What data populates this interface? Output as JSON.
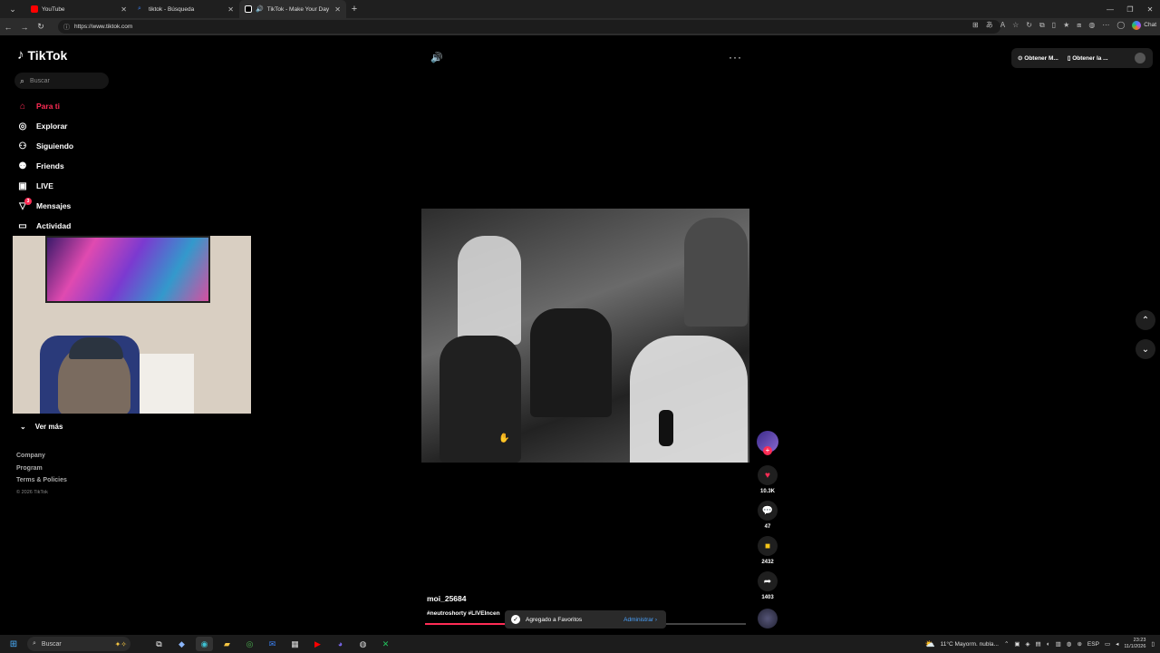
{
  "browser": {
    "tabs": [
      {
        "title": "YouTube",
        "color": "#ff0000"
      },
      {
        "title": "tiktok - Búsqueda",
        "color": "#3b82f6"
      },
      {
        "title": "TikTok - Make Your Day",
        "color": "#ffffff"
      }
    ],
    "url": "https://www.tiktok.com",
    "copilot_label": "Chat"
  },
  "tiktok": {
    "logo_text": "TikTok",
    "search_placeholder": "Buscar",
    "menu": [
      {
        "label": "Para ti",
        "icon": "home-icon"
      },
      {
        "label": "Explorar",
        "icon": "compass-icon"
      },
      {
        "label": "Siguiendo",
        "icon": "following-icon"
      },
      {
        "label": "Friends",
        "icon": "friends-icon"
      },
      {
        "label": "LIVE",
        "icon": "live-icon"
      },
      {
        "label": "Mensajes",
        "icon": "messages-icon",
        "badge": "3"
      },
      {
        "label": "Actividad",
        "icon": "activity-icon"
      }
    ],
    "ver_mas": "Ver más",
    "footer": {
      "company": "Company",
      "program": "Program",
      "terms": "Terms & Policies",
      "copyright": "© 2026 TikTok"
    },
    "top_right": {
      "btn1": "Obtener M...",
      "btn2": "Obtener la ..."
    },
    "video": {
      "username": "moi_25684",
      "caption": "#neutroshorty #LIVEIncen",
      "likes": "10.3K",
      "comments": "47",
      "saves": "2432",
      "shares": "1403",
      "progress": 0.3
    },
    "toast": {
      "message": "Agregado a Favoritos",
      "action": "Administrar"
    }
  },
  "taskbar": {
    "search_placeholder": "Buscar",
    "weather": "11°C  Mayorm. nubla...",
    "lang": "ESP",
    "time": "23:23",
    "date": "11/1/2026"
  }
}
